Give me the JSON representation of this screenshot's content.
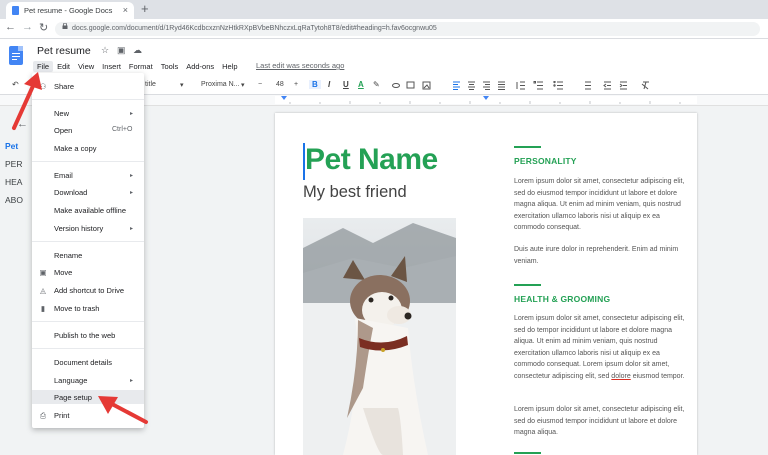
{
  "browser": {
    "tab_title": "Pet resume - Google Docs",
    "close_glyph": "×",
    "newtab_glyph": "+",
    "back_glyph": "←",
    "forward_glyph": "→",
    "reload_glyph": "↻",
    "url": "docs.google.com/document/d/1Ryd46KcdbcxznNzHtkRXpBVbeBNhczxLqRaTytoh8T8/edit#heading=h.fav6ocgnwu05"
  },
  "docs": {
    "title": "Pet resume",
    "star_glyph": "☆",
    "folder_glyph": "▣",
    "cloud_glyph": "☁",
    "menu": [
      "File",
      "Edit",
      "View",
      "Insert",
      "Format",
      "Tools",
      "Add-ons",
      "Help"
    ],
    "last_edit": "Last edit was seconds ago"
  },
  "format_toolbar": {
    "undo_glyph": "↶",
    "style_partial": "title",
    "font": "Proxima N...",
    "font_size": "48",
    "bold": "B",
    "italic": "I",
    "underline": "U",
    "text_color": "A"
  },
  "outline": {
    "back_glyph": "←",
    "items": [
      "Pet",
      "PER",
      "HEA",
      "ABO"
    ]
  },
  "file_menu": {
    "items": [
      {
        "label": "Share",
        "icon": "share-icon",
        "glyph": "⚇"
      },
      {
        "label": "New",
        "submenu": true
      },
      {
        "label": "Open",
        "shortcut": "Ctrl+O"
      },
      {
        "label": "Make a copy"
      },
      {
        "label": "Email",
        "submenu": true
      },
      {
        "label": "Download",
        "submenu": true
      },
      {
        "label": "Make available offline"
      },
      {
        "label": "Version history",
        "submenu": true
      },
      {
        "label": "Rename"
      },
      {
        "label": "Move",
        "icon": "folder-move-icon",
        "glyph": "▣"
      },
      {
        "label": "Add shortcut to Drive",
        "icon": "drive-shortcut-icon",
        "glyph": "◬"
      },
      {
        "label": "Move to trash",
        "icon": "trash-icon",
        "glyph": "▮"
      },
      {
        "label": "Publish to the web"
      },
      {
        "label": "Document details"
      },
      {
        "label": "Language",
        "submenu": true
      },
      {
        "label": "Page setup"
      },
      {
        "label": "Print",
        "icon": "print-icon",
        "glyph": "⎙"
      }
    ],
    "submenu_glyph": "▸"
  },
  "document": {
    "heading": "Pet Name",
    "subtitle": "My best friend",
    "sections": [
      {
        "heading": "PERSONALITY",
        "paragraphs": [
          "Lorem ipsum dolor sit amet, consectetur adipiscing elit, sed do eiusmod tempor incididunt ut labore et dolore magna aliqua. Ut enim ad minim veniam, quis nostrud exercitation ullamco laboris nisi ut aliquip ex ea commodo consequat.",
          "Duis aute irure dolor in reprehenderit. Enim ad minim veniam."
        ]
      },
      {
        "heading": "HEALTH & GROOMING",
        "paragraphs": [
          "Lorem ipsum dolor sit amet, consectetur adipiscing elit, sed do tempor incididunt ut labore et dolore magna aliqua. Ut enim ad minim veniam, quis nostrud exercitation ullamco laboris nisi ut aliquip ex ea commodo consequat. Lorem ipsum dolor sit amet, consectetur adipiscing elit, sed",
          "dolore",
          "eiusmod tempor.",
          "Lorem ipsum dolor sit amet, consectetur adipiscing elit, sed do eiusmod tempor incididunt ut labore et dolore magna aliqua."
        ]
      }
    ]
  },
  "colors": {
    "accent_green": "#24a155",
    "docs_blue": "#4285f4",
    "annotation_red": "#e53935"
  }
}
